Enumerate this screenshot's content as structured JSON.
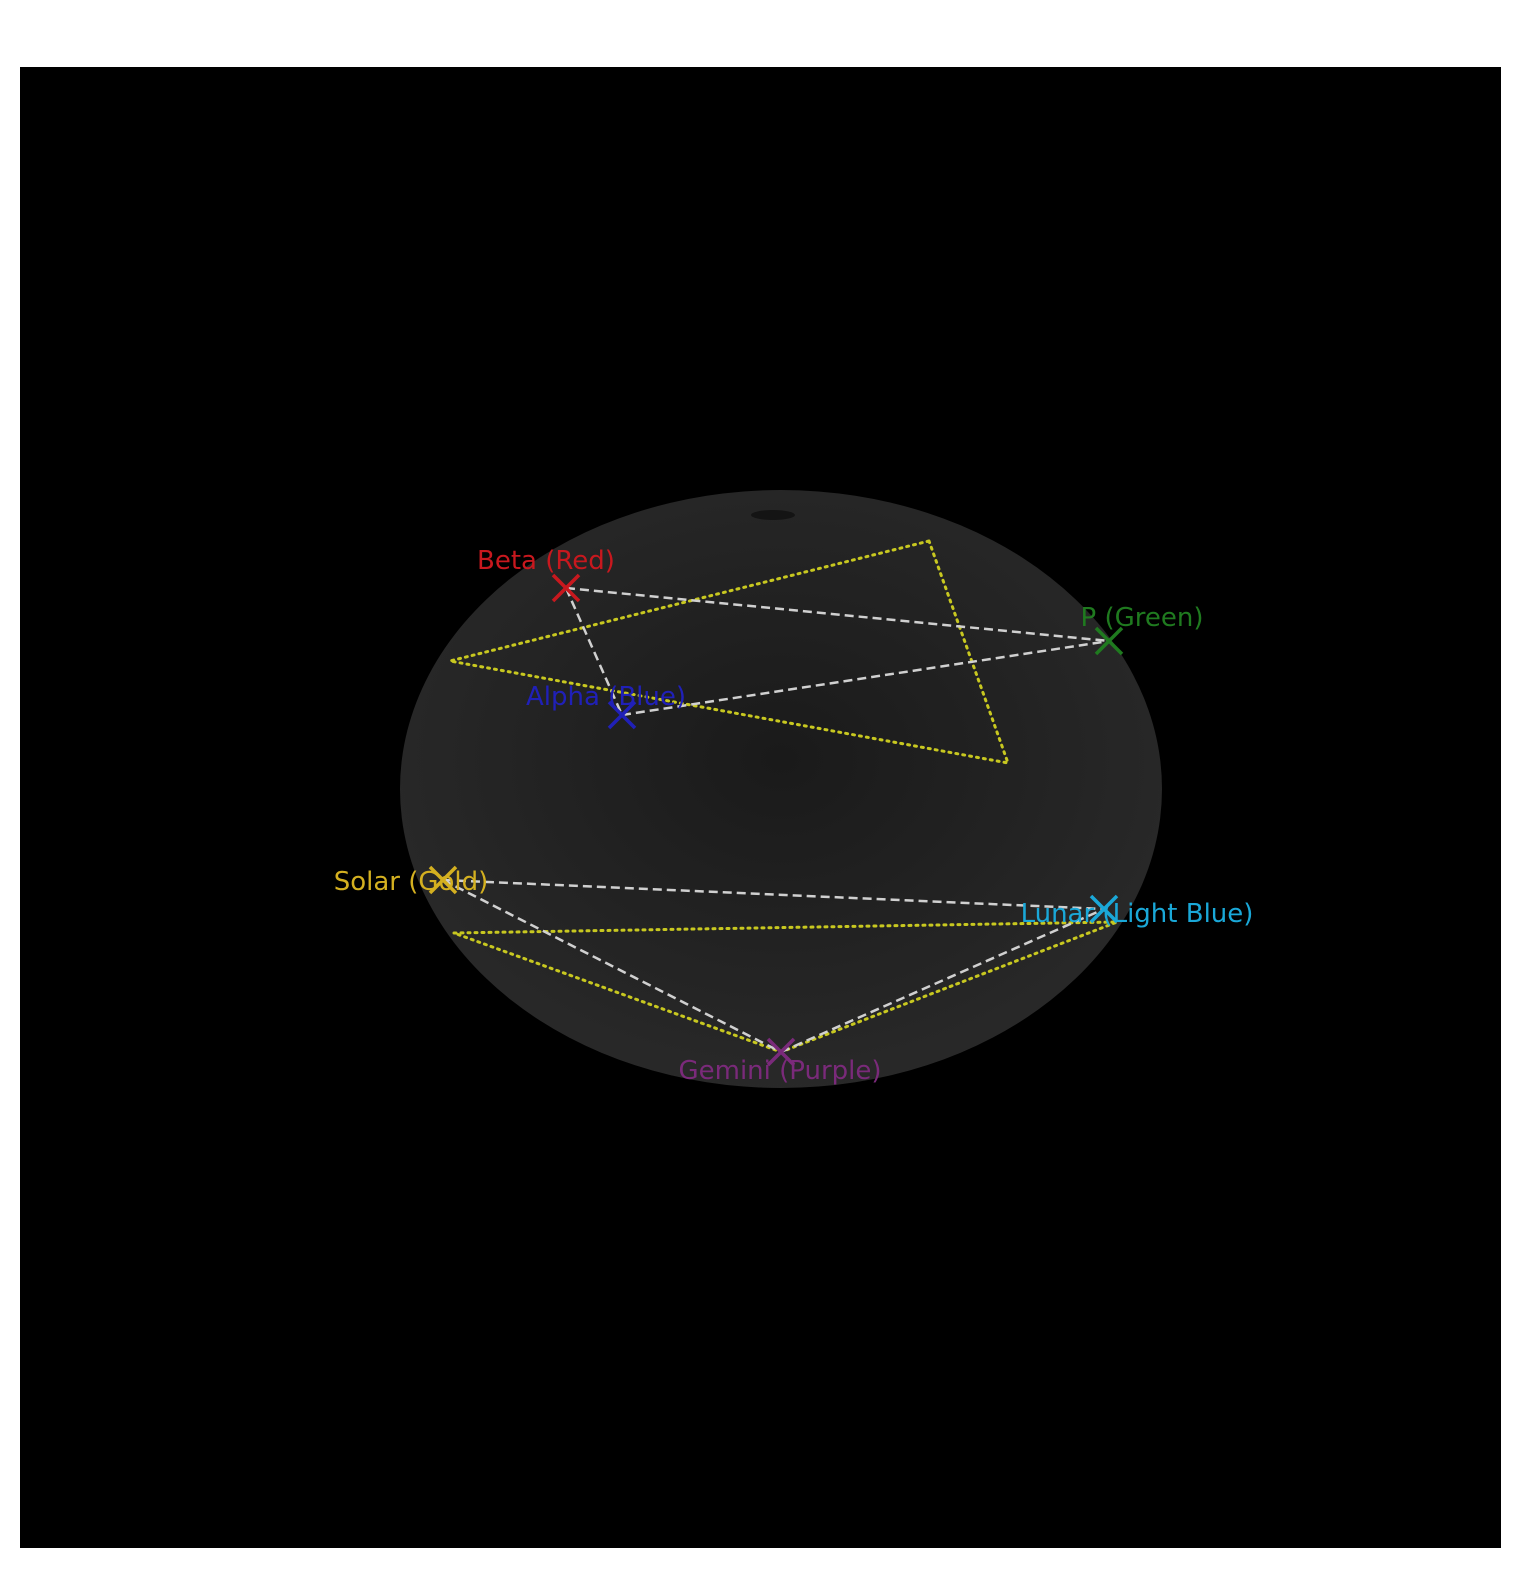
{
  "background": "#000000",
  "disc": {
    "fill_center": "#1a1a1a",
    "fill_edge": "#2a2a2a"
  },
  "nodes": [
    {
      "id": "beta",
      "label": "Beta (Red)",
      "color": "#c8181e"
    },
    {
      "id": "green",
      "label": "P (Green)",
      "color": "#1f7a1f"
    },
    {
      "id": "alpha",
      "label": "Alpha (Blue)",
      "color": "#2020b8"
    },
    {
      "id": "solar",
      "label": "Solar (Gold)",
      "color": "#d4b020"
    },
    {
      "id": "lunar",
      "label": "Lunar (Light Blue)",
      "color": "#1aa8d8"
    },
    {
      "id": "gemini",
      "label": "Gemini (Purple)",
      "color": "#7a2a7a"
    }
  ],
  "links": [
    {
      "from": "beta",
      "to": "green"
    },
    {
      "from": "beta",
      "to": "alpha"
    },
    {
      "from": "alpha",
      "to": "green"
    },
    {
      "from": "solar",
      "to": "lunar"
    },
    {
      "from": "solar",
      "to": "gemini"
    },
    {
      "from": "gemini",
      "to": "lunar"
    }
  ],
  "link_color": "#d0d0d0",
  "overlay_color": "#c8c820"
}
